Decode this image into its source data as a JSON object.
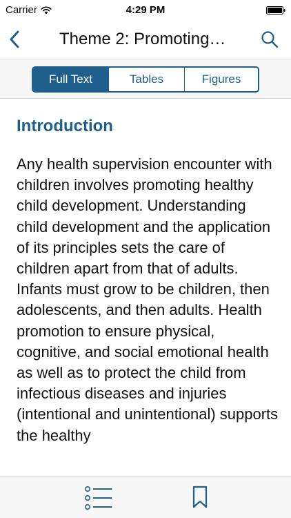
{
  "status_bar": {
    "carrier": "Carrier",
    "time": "4:29 PM"
  },
  "nav": {
    "title": "Theme 2: Promoting…"
  },
  "segments": [
    {
      "label": "Full Text",
      "selected": true
    },
    {
      "label": "Tables",
      "selected": false
    },
    {
      "label": "Figures",
      "selected": false
    }
  ],
  "content": {
    "heading": "Introduction",
    "body": "Any health supervision encounter with children involves promoting healthy child development. Understanding child development and the application of its principles sets the care of children apart from that of adults. Infants must grow to be children, then adolescents, and then adults. Health promotion to ensure physical, cognitive, and social emotional health as well as to protect the child from infectious diseases and injuries (intentional and unintentional) supports the healthy"
  },
  "colors": {
    "accent": "#1f5f8b",
    "segment_bar_bg": "#f6f6f6",
    "tab_bar_bg": "#f7f7f7"
  },
  "icons": {
    "back": "chevron-left-icon",
    "search": "search-icon",
    "toc": "list-icon",
    "bookmark": "bookmark-icon"
  }
}
